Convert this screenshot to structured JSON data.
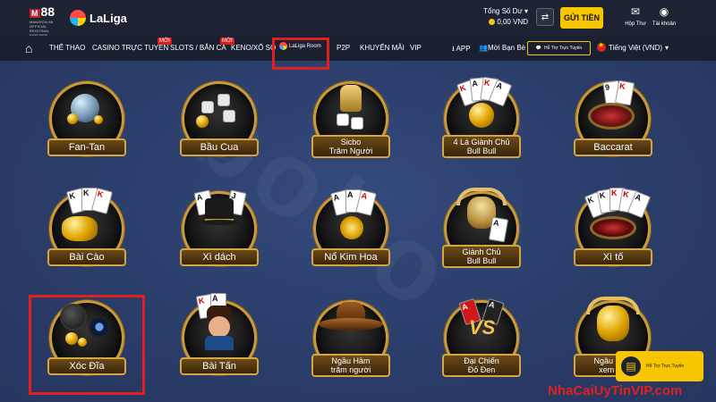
{
  "header": {
    "brand_m88_badge": "M",
    "brand_m88_text": "88",
    "brand_m88_sub": "MANSION 88\nOFFICIAL REGIONAL PARTNER",
    "brand_laliga": "LaLiga",
    "balance_label": "Tổng Số Dư",
    "balance_value": "0,00 VND",
    "deposit_button": "GỬI TIỀN",
    "mail_label": "Hộp Thư",
    "account_label": "Tài khoản"
  },
  "nav": {
    "items": [
      "THỂ THAO",
      "CASINO TRỰC TUYẾN",
      "SLOTS / BẮN CÁ",
      "KENO/XỔ SỐ",
      "P2P",
      "KHUYẾN MÃI",
      "VIP"
    ],
    "new_badge": "MỚI",
    "laliga_room": "LaLiga Room",
    "app": "APP",
    "invite": "Mời Bạn Bè",
    "support": "Hỗ Trợ Trực Tuyến",
    "language": "Tiếng Việt (VND)"
  },
  "games": [
    {
      "label": "Fan-Tan"
    },
    {
      "label": "Bầu Cua"
    },
    {
      "label": "Sicbo\nTrăm Người"
    },
    {
      "label": "4 Lá Giành Chủ\nBull Bull"
    },
    {
      "label": "Baccarat"
    },
    {
      "label": "Bài Cào"
    },
    {
      "label": "Xì dách"
    },
    {
      "label": "Nổ Kim Hoa"
    },
    {
      "label": "Giành Chủ\nBull Bull"
    },
    {
      "label": "Xì tố"
    },
    {
      "label": "Xóc Đĩa"
    },
    {
      "label": "Bài Tấn"
    },
    {
      "label": "Ngầu Hầm\ntrăm người"
    },
    {
      "label": "Đại Chiến\nĐỏ Đen"
    },
    {
      "label": "Ngầu Hầm\nxem bài"
    }
  ],
  "watermark": "NhaCaiUyTinVIP.com",
  "float_support": "Hỗ Trợ Trực Tuyến",
  "colors": {
    "accent": "#f7c600",
    "highlight": "#e02020",
    "background": "#2c3e6b",
    "topbar": "#1d2332"
  }
}
